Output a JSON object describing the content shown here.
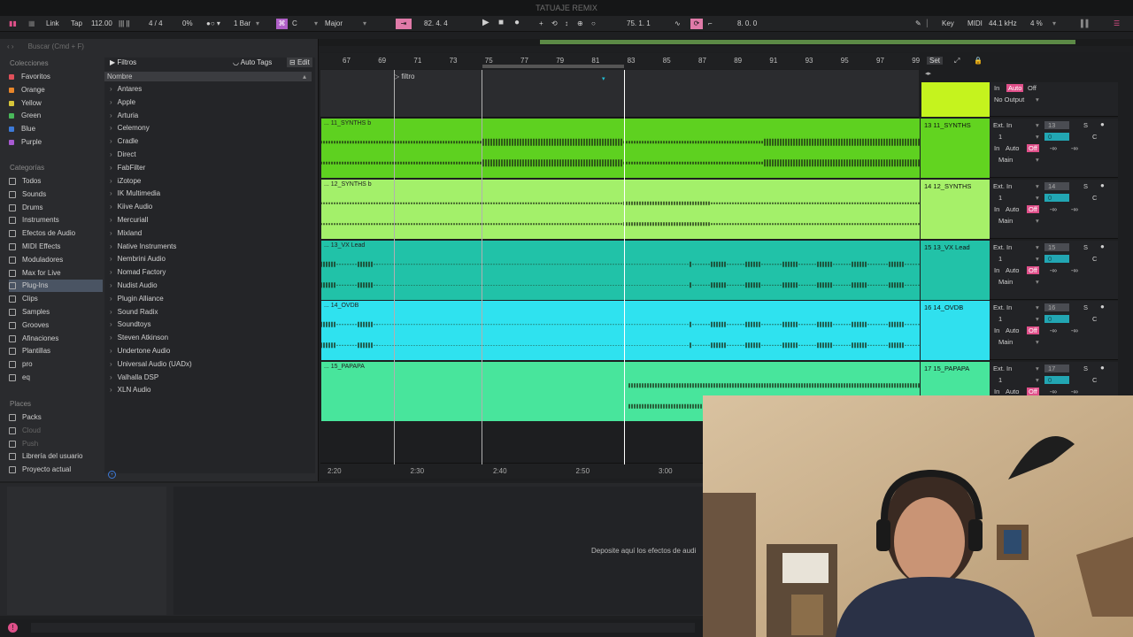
{
  "window": {
    "title": "TATUAJE REMIX"
  },
  "transport": {
    "link": "Link",
    "tap": "Tap",
    "tempo": "112.00",
    "signature": "4 / 4",
    "swing": "0%",
    "quantize": "1 Bar",
    "key_root": "C",
    "scale": "Major",
    "position": "82.  4.  4",
    "loop_start": "75.  1.  1",
    "loop_length": "8.  0.  0",
    "key": "Key",
    "midi": "MIDI",
    "sample_rate": "44.1 kHz",
    "cpu": "4 %"
  },
  "browser": {
    "search_placeholder": "Buscar (Cmd + F)",
    "collections_title": "Colecciones",
    "collections": [
      {
        "label": "Favoritos",
        "color": "#e0505a"
      },
      {
        "label": "Orange",
        "color": "#e8862a"
      },
      {
        "label": "Yellow",
        "color": "#d7c63a"
      },
      {
        "label": "Green",
        "color": "#49b85a"
      },
      {
        "label": "Blue",
        "color": "#3d7ad8"
      },
      {
        "label": "Purple",
        "color": "#a85ad2"
      }
    ],
    "categories_title": "Categorías",
    "categories": [
      {
        "label": "Todos"
      },
      {
        "label": "Sounds"
      },
      {
        "label": "Drums"
      },
      {
        "label": "Instruments"
      },
      {
        "label": "Efectos de Audio"
      },
      {
        "label": "MIDI Effects"
      },
      {
        "label": "Moduladores"
      },
      {
        "label": "Max for Live"
      },
      {
        "label": "Plug-Ins"
      },
      {
        "label": "Clips"
      },
      {
        "label": "Samples"
      },
      {
        "label": "Grooves"
      },
      {
        "label": "Afinaciones"
      },
      {
        "label": "Plantillas"
      },
      {
        "label": "pro"
      },
      {
        "label": "eq"
      }
    ],
    "places_title": "Places",
    "places": [
      {
        "label": "Packs"
      },
      {
        "label": "Cloud"
      },
      {
        "label": "Push"
      },
      {
        "label": "Librería del usuario"
      },
      {
        "label": "Proyecto actual"
      }
    ],
    "filters": "Filtros",
    "auto_tags": "Auto Tags",
    "edit": "Edit",
    "name_header": "Nombre",
    "vendors": [
      "Antares",
      "Apple",
      "Arturia",
      "Celemony",
      "Cradle",
      "Direct",
      "FabFilter",
      "iZotope",
      "IK Multimedia",
      "Kiive Audio",
      "Mercuriall",
      "Mixland",
      "Native Instruments",
      "Nembrini Audio",
      "Nomad Factory",
      "Nudist Audio",
      "Plugin Alliance",
      "Sound Radix",
      "Soundtoys",
      "Steven Atkinson",
      "Undertone Audio",
      "Universal Audio (UADx)",
      "Valhalla DSP",
      "XLN Audio"
    ]
  },
  "arrangement": {
    "bars": [
      "67",
      "69",
      "71",
      "73",
      "75",
      "77",
      "79",
      "81",
      "83",
      "85",
      "87",
      "89",
      "91",
      "93",
      "95",
      "97",
      "99"
    ],
    "set_label": "Set",
    "locator": "filtro",
    "times": [
      "2:20",
      "2:30",
      "2:40",
      "2:50",
      "3:00"
    ],
    "master": {
      "in": "In",
      "auto": "Auto",
      "off": "Off",
      "output": "No Output"
    },
    "tracks": [
      {
        "clip": "... 11_SYNTHS b",
        "header": "13 11_SYNTHS",
        "input": "Ext. In",
        "ch": "1",
        "num": "13",
        "out": "Main",
        "color": "#5ed120",
        "hcolor": "#62d420"
      },
      {
        "clip": "... 12_SYNTHS b",
        "header": "14 12_SYNTHS",
        "input": "Ext. In",
        "ch": "1",
        "num": "14",
        "out": "Main",
        "color": "#a3f06a",
        "hcolor": "#a6f069"
      },
      {
        "clip": "... 13_VX Lead",
        "header": "15 13_VX Lead",
        "input": "Ext. In",
        "ch": "1",
        "num": "15",
        "out": "Main",
        "color": "#21c2a8",
        "hcolor": "#22c2a8"
      },
      {
        "clip": "... 14_OVDB",
        "header": "16 14_OVDB",
        "input": "Ext. In",
        "ch": "1",
        "num": "16",
        "out": "Main",
        "color": "#2fe2ef",
        "hcolor": "#30e0ee"
      },
      {
        "clip": "... 15_PAPAPA",
        "header": "17 15_PAPAPA",
        "input": "Ext. In",
        "ch": "1",
        "num": "17",
        "out": "Main",
        "color": "#48e59c",
        "hcolor": "#48e59c"
      }
    ],
    "solo": "S",
    "center": "C",
    "volume": "0",
    "minus_inf": "-∞"
  },
  "detail": {
    "drop_text": "Deposite aquí los efectos de audi"
  }
}
